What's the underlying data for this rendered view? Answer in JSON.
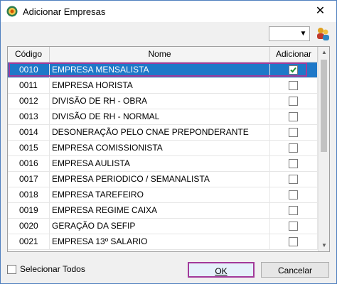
{
  "window": {
    "title": "Adicionar Empresas",
    "close_label": "✕"
  },
  "toolbar": {
    "combo_value": "",
    "combo_arrow": "▼"
  },
  "grid": {
    "columns": [
      "Código",
      "Nome",
      "Adicionar"
    ],
    "rows": [
      {
        "code": "0010",
        "name": "EMPRESA MENSALISTA",
        "checked": true,
        "selected": true
      },
      {
        "code": "0011",
        "name": "EMPRESA HORISTA",
        "checked": false
      },
      {
        "code": "0012",
        "name": "DIVISÃO DE RH - OBRA",
        "checked": false
      },
      {
        "code": "0013",
        "name": "DIVISÃO DE RH - NORMAL",
        "checked": false
      },
      {
        "code": "0014",
        "name": "DESONERAÇÃO PELO CNAE PREPONDERANTE",
        "checked": false
      },
      {
        "code": "0015",
        "name": "EMPRESA COMISSIONISTA",
        "checked": false
      },
      {
        "code": "0016",
        "name": "EMPRESA AULISTA",
        "checked": false
      },
      {
        "code": "0017",
        "name": "EMPRESA PERIODICO / SEMANALISTA",
        "checked": false
      },
      {
        "code": "0018",
        "name": "EMPRESA TAREFEIRO",
        "checked": false
      },
      {
        "code": "0019",
        "name": "EMPRESA REGIME CAIXA",
        "checked": false
      },
      {
        "code": "0020",
        "name": "GERAÇÃO DA SEFIP",
        "checked": false
      },
      {
        "code": "0021",
        "name": "EMPRESA 13º SALARIO",
        "checked": false
      }
    ]
  },
  "footer": {
    "select_all_label": "Selecionar Todos",
    "ok_label": "OK",
    "cancel_label": "Cancelar"
  },
  "colors": {
    "selection": "#1e78c8",
    "highlight_border": "#a23a9a"
  }
}
